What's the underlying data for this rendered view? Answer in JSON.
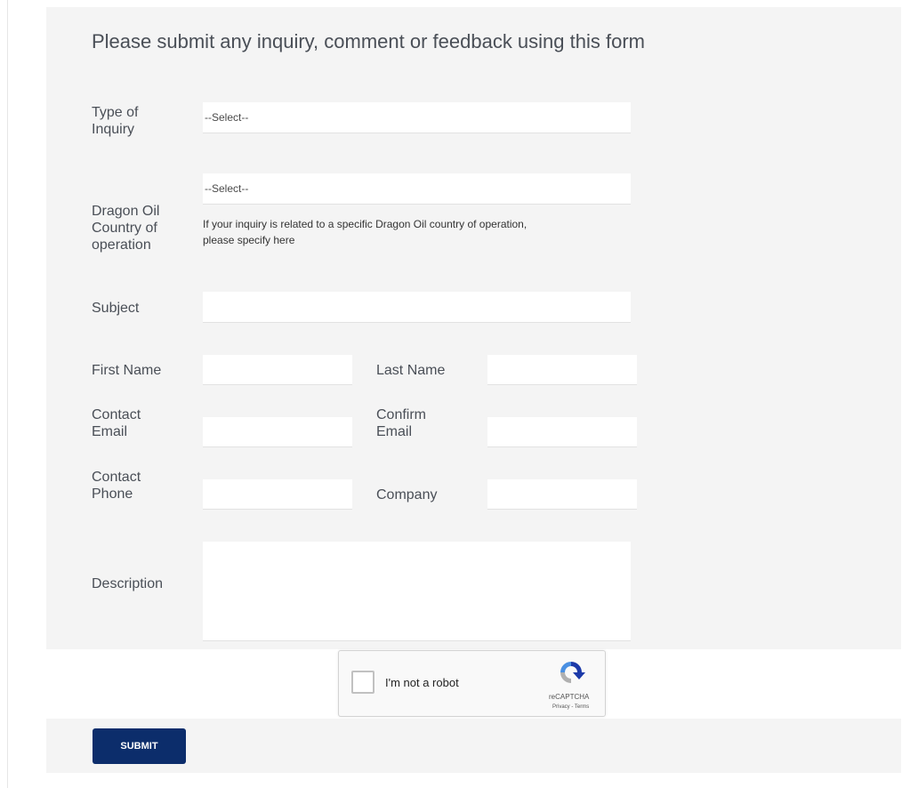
{
  "form": {
    "heading": "Please submit any inquiry, comment or feedback using this form",
    "type_of_inquiry": {
      "label_lines": [
        "Type of",
        "Inquiry"
      ],
      "selected": "--Select--"
    },
    "country": {
      "label_lines": [
        "Dragon Oil",
        "Country of",
        "operation"
      ],
      "selected": "--Select--",
      "hint_lines": [
        "If your inquiry is related to a specific Dragon Oil country of operation,",
        "please specify here"
      ]
    },
    "subject": {
      "label": "Subject",
      "value": ""
    },
    "first_name": {
      "label": "First Name",
      "value": ""
    },
    "last_name": {
      "label": "Last Name",
      "value": ""
    },
    "contact_email": {
      "label_lines": [
        "Contact",
        "Email"
      ],
      "value": ""
    },
    "confirm_email": {
      "label_lines": [
        "Confirm",
        "Email"
      ],
      "value": ""
    },
    "contact_phone": {
      "label_lines": [
        "Contact",
        "Phone"
      ],
      "value": ""
    },
    "company": {
      "label": "Company",
      "value": ""
    },
    "description": {
      "label": "Description",
      "value": ""
    }
  },
  "captcha": {
    "text": "I'm not a robot",
    "brand": "reCAPTCHA",
    "links": "Privacy - Terms",
    "icon": "recaptcha-logo-icon"
  },
  "submit": {
    "label": "SUBMIT"
  },
  "colors": {
    "panel_bg": "#f4f4f4",
    "button_bg": "#0c2d6b",
    "text": "#4a4f57"
  }
}
